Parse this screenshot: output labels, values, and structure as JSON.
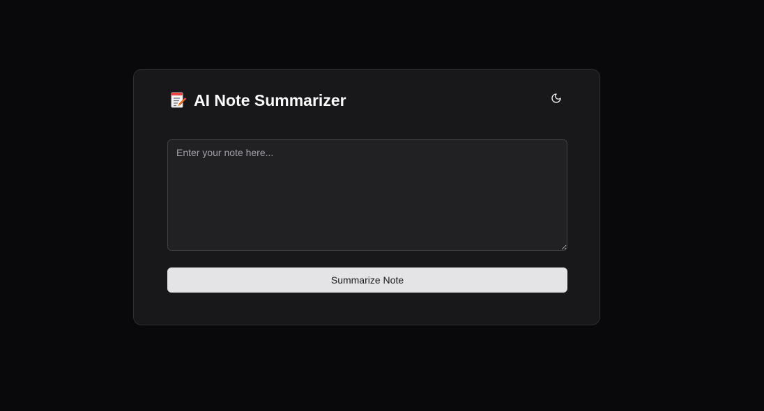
{
  "app": {
    "title": "AI Note Summarizer",
    "title_icon": "memo-icon",
    "theme_toggle_icon": "moon-icon"
  },
  "note": {
    "value": "",
    "placeholder": "Enter your note here..."
  },
  "actions": {
    "summarize_label": "Summarize Note"
  },
  "colors": {
    "background": "#09090b",
    "card": "#18181b",
    "input": "#212124",
    "button": "#e4e4e7",
    "button_text": "#18181b",
    "title_text": "#fafafa"
  }
}
